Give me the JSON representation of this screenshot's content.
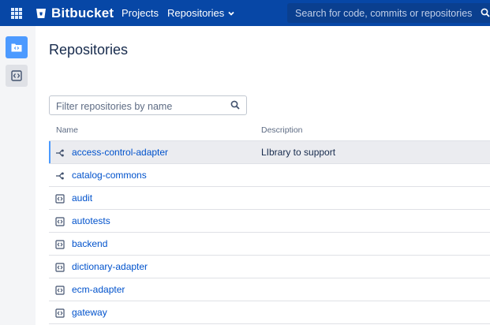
{
  "topnav": {
    "logo_text": "Bitbucket",
    "projects_label": "Projects",
    "repositories_label": "Repositories",
    "search_placeholder": "Search for code, commits or repositories..."
  },
  "page": {
    "title": "Repositories",
    "filter_placeholder": "Filter repositories by name"
  },
  "table": {
    "columns": [
      "Name",
      "Description"
    ],
    "rows": [
      {
        "name": "access-control-adapter",
        "description": "LIbrary to support",
        "icon": "fork-icon",
        "selected": true
      },
      {
        "name": "catalog-commons",
        "description": "",
        "icon": "fork-icon",
        "selected": false
      },
      {
        "name": "audit",
        "description": "",
        "icon": "code-repo-icon",
        "selected": false
      },
      {
        "name": "autotests",
        "description": "",
        "icon": "code-repo-icon",
        "selected": false
      },
      {
        "name": "backend",
        "description": "",
        "icon": "code-repo-icon",
        "selected": false
      },
      {
        "name": "dictionary-adapter",
        "description": "",
        "icon": "code-repo-icon",
        "selected": false
      },
      {
        "name": "ecm-adapter",
        "description": "",
        "icon": "code-repo-icon",
        "selected": false
      },
      {
        "name": "gateway",
        "description": "",
        "icon": "code-repo-icon",
        "selected": false
      }
    ]
  },
  "colors": {
    "nav_bg": "#0747a6",
    "link": "#0052cc",
    "sidebar_active": "#4c9aff"
  }
}
